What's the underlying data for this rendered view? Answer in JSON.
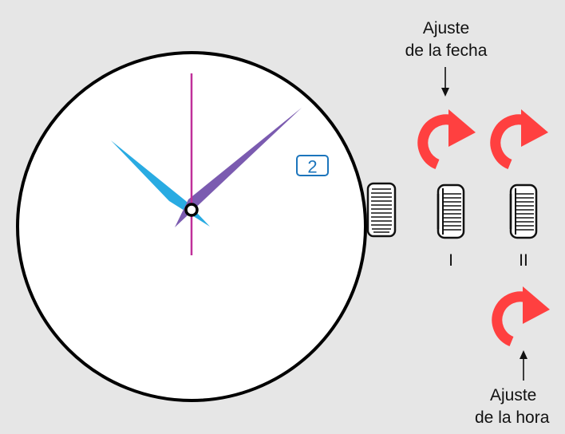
{
  "date_window": {
    "value": "2"
  },
  "date_adjust_label": {
    "line1": "Ajuste",
    "line2": "de la fecha"
  },
  "time_adjust_label": {
    "line1": "Ajuste",
    "line2": "de la hora"
  },
  "crown_positions": [
    {
      "label": "I"
    },
    {
      "label": "II"
    }
  ],
  "colors": {
    "background": "#e6e6e6",
    "dial": "#ffffff",
    "case_outline": "#000000",
    "hour_hand": "#29abe2",
    "minute_hand": "#7b5bb0",
    "second_hand": "#c0309a",
    "rotation_arrows": "#ff4040",
    "date_window": "#1c75bc"
  },
  "icons": {
    "rotation": "clockwise-rotation-arrow-icon",
    "pointer": "arrow-icon",
    "crown": "crown-icon"
  }
}
